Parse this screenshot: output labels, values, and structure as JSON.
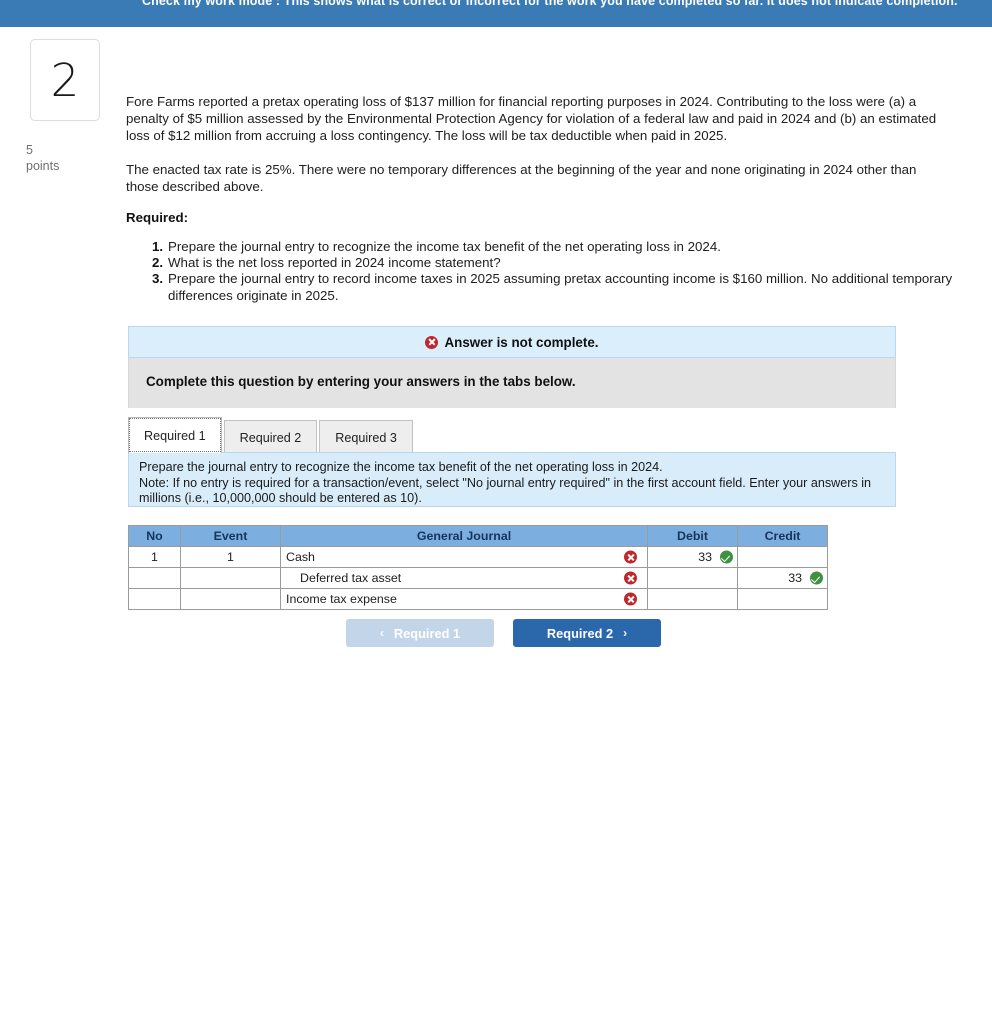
{
  "banner": {
    "text": "Check my work mode : This shows what is correct or incorrect for the work you have completed so far. It does not indicate completion.",
    "bg_color": "#3a7ab5"
  },
  "question": {
    "number": "2",
    "points_value": "5",
    "points_label": "points"
  },
  "problem": {
    "paragraph_1": "Fore Farms reported a pretax operating loss of $137 million for financial reporting purposes in 2024. Contributing to the loss were (a) a penalty of $5 million assessed by the Environmental Protection Agency for violation of a federal law and paid in 2024 and (b) an estimated loss of $12 million from accruing a loss contingency. The loss will be tax deductible when paid in 2025.",
    "paragraph_2": "The enacted tax rate is 25%. There were no temporary differences at the beginning of the year and none originating in 2024 other than those described above.",
    "required_heading": "Required:",
    "required_items": [
      "Prepare the journal entry to recognize the income tax benefit of the net operating loss in 2024.",
      "What is the net loss reported in 2024 income statement?",
      "Prepare the journal entry to record income taxes in 2025 assuming pretax accounting income is $160 million. No additional temporary differences originate in 2025."
    ]
  },
  "alert": {
    "text": "Answer is not complete.",
    "icon": "error-x-icon",
    "bg_color": "#dbeefb"
  },
  "complete_bar": {
    "text": "Complete this question by entering your answers in the tabs below."
  },
  "tabs": [
    {
      "label": "Required 1",
      "active": true
    },
    {
      "label": "Required 2",
      "active": false
    },
    {
      "label": "Required 3",
      "active": false
    }
  ],
  "tab_instruction": {
    "prompt": "Prepare the journal entry to recognize the income tax benefit of the net operating loss in 2024.",
    "note": "Note: If no entry is required for a transaction/event, select \"No journal entry required\" in the first account field. Enter your answers in millions (i.e., 10,000,000 should be entered as 10).",
    "note_color": "#b03a3a"
  },
  "journal": {
    "columns": [
      "No",
      "Event",
      "General Journal",
      "Debit",
      "Credit"
    ],
    "rows": [
      {
        "no": "1",
        "event": "1",
        "account": "Cash",
        "indent": false,
        "account_mark": "error-x-icon",
        "debit": "33",
        "debit_mark": "check-icon",
        "credit": "",
        "credit_mark": ""
      },
      {
        "no": "",
        "event": "",
        "account": "Deferred tax asset",
        "indent": true,
        "account_mark": "error-x-icon",
        "debit": "",
        "debit_mark": "",
        "credit": "33",
        "credit_mark": "check-icon"
      },
      {
        "no": "",
        "event": "",
        "account": "Income tax expense",
        "indent": false,
        "account_mark": "error-x-icon",
        "debit": "",
        "debit_mark": "",
        "credit": "",
        "credit_mark": ""
      }
    ]
  },
  "nav": {
    "prev_label": "Required 1",
    "prev_chevron": "‹",
    "prev_disabled": true,
    "next_label": "Required 2",
    "next_chevron": "›",
    "next_color": "#2b68ab"
  }
}
